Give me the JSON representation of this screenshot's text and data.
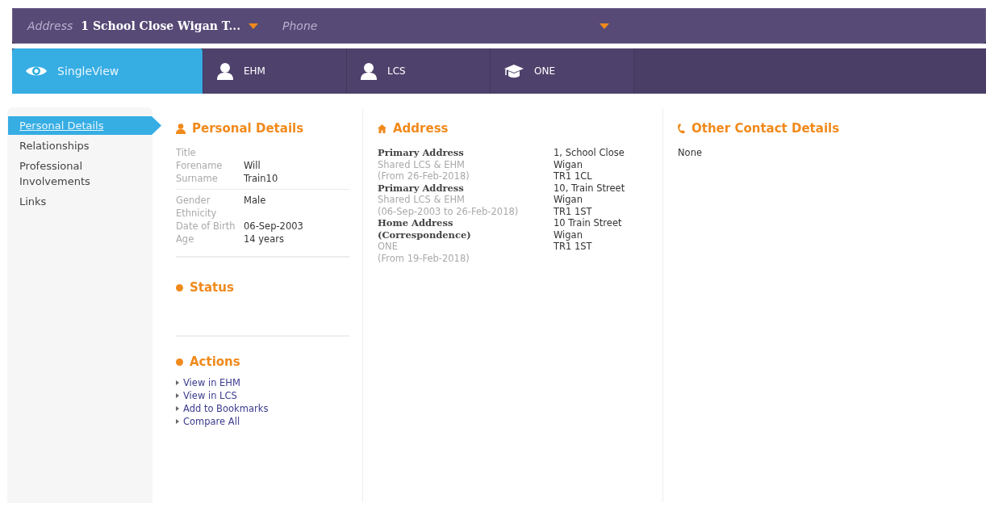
{
  "header": {
    "address_label": "Address",
    "address_value": "1 School Close Wigan T...",
    "phone_label": "Phone"
  },
  "tabs": [
    {
      "label": "SingleView",
      "kind": "eye",
      "selected": true
    },
    {
      "label": "EHM",
      "kind": "person",
      "selected": false
    },
    {
      "label": "LCS",
      "kind": "person",
      "selected": false
    },
    {
      "label": "ONE",
      "kind": "cap",
      "selected": false
    }
  ],
  "sidebar": {
    "items": [
      {
        "label": "Personal Details",
        "selected": true
      },
      {
        "label": "Relationships",
        "selected": false
      },
      {
        "label": "Professional Involvements",
        "selected": false
      },
      {
        "label": "Links",
        "selected": false
      }
    ]
  },
  "personal_details": {
    "title": "Personal Details",
    "groups": [
      [
        {
          "label": "Title"
        },
        {
          "label": "Forename",
          "value": "Will"
        },
        {
          "label": "Surname",
          "value": "Train10"
        }
      ],
      [
        {
          "label": "Gender",
          "value": "Male"
        },
        {
          "label": "Ethnicity"
        },
        {
          "label": "Date of Birth",
          "value": "06-Sep-2003"
        },
        {
          "label": "Age",
          "value": "14 years"
        }
      ]
    ]
  },
  "status": {
    "title": "Status"
  },
  "actions": {
    "title": "Actions",
    "links": [
      "View in EHM",
      "View in LCS",
      "Add to Bookmarks",
      "Compare All"
    ]
  },
  "address": {
    "title": "Address",
    "entries": [
      {
        "type": [
          "Primary Address"
        ],
        "source": "Shared LCS & EHM",
        "period": "(From 26-Feb-2018)",
        "lines": [
          "1, School Close",
          "Wigan",
          "TR1 1CL"
        ]
      },
      {
        "type": [
          "Primary Address"
        ],
        "source": "Shared LCS & EHM",
        "period": "(06-Sep-2003 to 26-Feb-2018)",
        "lines": [
          "10, Train Street",
          "Wigan",
          "TR1 1ST"
        ]
      },
      {
        "type": [
          "Home Address",
          "(Correspondence)"
        ],
        "source": "ONE",
        "period": "(From 19-Feb-2018)",
        "lines": [
          "10 Train Street",
          "Wigan",
          "TR1 1ST"
        ]
      }
    ]
  },
  "other_contact": {
    "title": "Other Contact Details",
    "value": "None"
  }
}
